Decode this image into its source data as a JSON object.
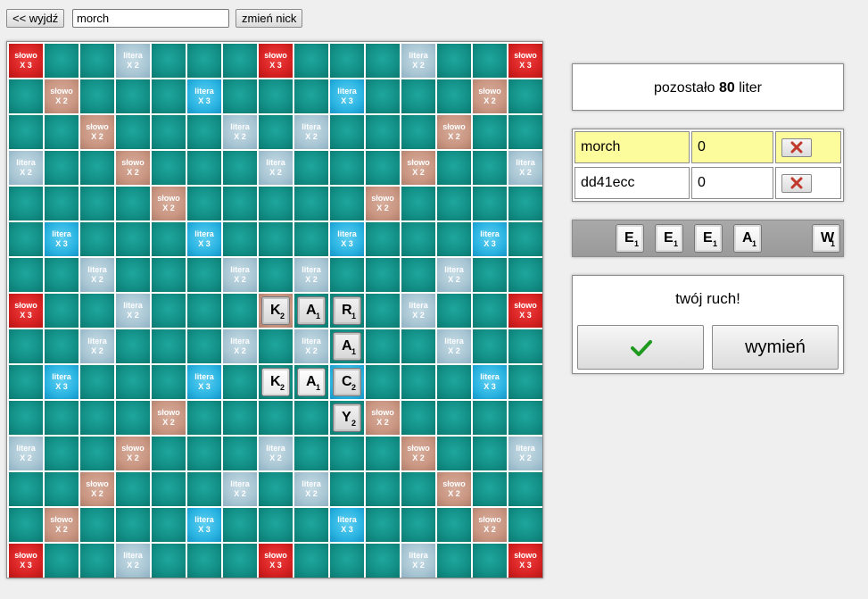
{
  "topbar": {
    "exit_label": "<< wyjdź",
    "nick_value": "morch",
    "change_nick_label": "zmień nick"
  },
  "bonus_labels": {
    "w3": [
      "słowo",
      "X 3"
    ],
    "w2": [
      "słowo",
      "X 2"
    ],
    "l3": [
      "litera",
      "X 3"
    ],
    "l2": [
      "litera",
      "X 2"
    ]
  },
  "board": {
    "size": 15,
    "rows": [
      "W..-...W...-..W",
      ".w...L...L...w.",
      "..w...-.-...w..",
      "-..w...-...w..-",
      "....w.....w....",
      ".L...L...L...L.",
      "..-...-.-...-..",
      "W..-...w...-..W",
      "..-...-.-...-..",
      ".L...L...L...L.",
      "....w.....w....",
      "-..w...-...w..-",
      "..w...-.-...w..",
      ".w...L...L...w.",
      "W..-...W...-..W"
    ],
    "tiles": [
      {
        "row": 7,
        "col": 7,
        "letter": "K",
        "points": "2",
        "fresh": false
      },
      {
        "row": 7,
        "col": 8,
        "letter": "A",
        "points": "1",
        "fresh": false
      },
      {
        "row": 7,
        "col": 9,
        "letter": "R",
        "points": "1",
        "fresh": false
      },
      {
        "row": 8,
        "col": 9,
        "letter": "A",
        "points": "1",
        "fresh": false
      },
      {
        "row": 9,
        "col": 7,
        "letter": "K",
        "points": "2",
        "fresh": true
      },
      {
        "row": 9,
        "col": 8,
        "letter": "A",
        "points": "1",
        "fresh": true
      },
      {
        "row": 9,
        "col": 9,
        "letter": "C",
        "points": "2",
        "fresh": false
      },
      {
        "row": 10,
        "col": 9,
        "letter": "Y",
        "points": "2",
        "fresh": false
      }
    ]
  },
  "remaining": {
    "prefix": "pozostało",
    "count": "80",
    "suffix": "liter"
  },
  "players": [
    {
      "name": "morch",
      "score": "0",
      "active": true
    },
    {
      "name": "dd41ecc",
      "score": "0",
      "active": false
    }
  ],
  "rack": [
    {
      "slot": 1,
      "letter": "E",
      "points": "1"
    },
    {
      "slot": 2,
      "letter": "E",
      "points": "1"
    },
    {
      "slot": 3,
      "letter": "E",
      "points": "1"
    },
    {
      "slot": 4,
      "letter": "A",
      "points": "1"
    },
    {
      "slot": 6,
      "letter": "W",
      "points": "1"
    }
  ],
  "turn": {
    "message": "twój ruch!",
    "confirm_icon": "checkmark-icon",
    "exchange_label": "wymień"
  },
  "colors": {
    "board_cell": "#139188",
    "word_x3": "#d72222",
    "word_x2": "#c99682",
    "letter_x3": "#2bb4e2",
    "letter_x2": "#a9c6d4",
    "active_player": "#fcfc9c",
    "checkmark": "#1f9a1f",
    "delete_x": "#c0392b"
  }
}
